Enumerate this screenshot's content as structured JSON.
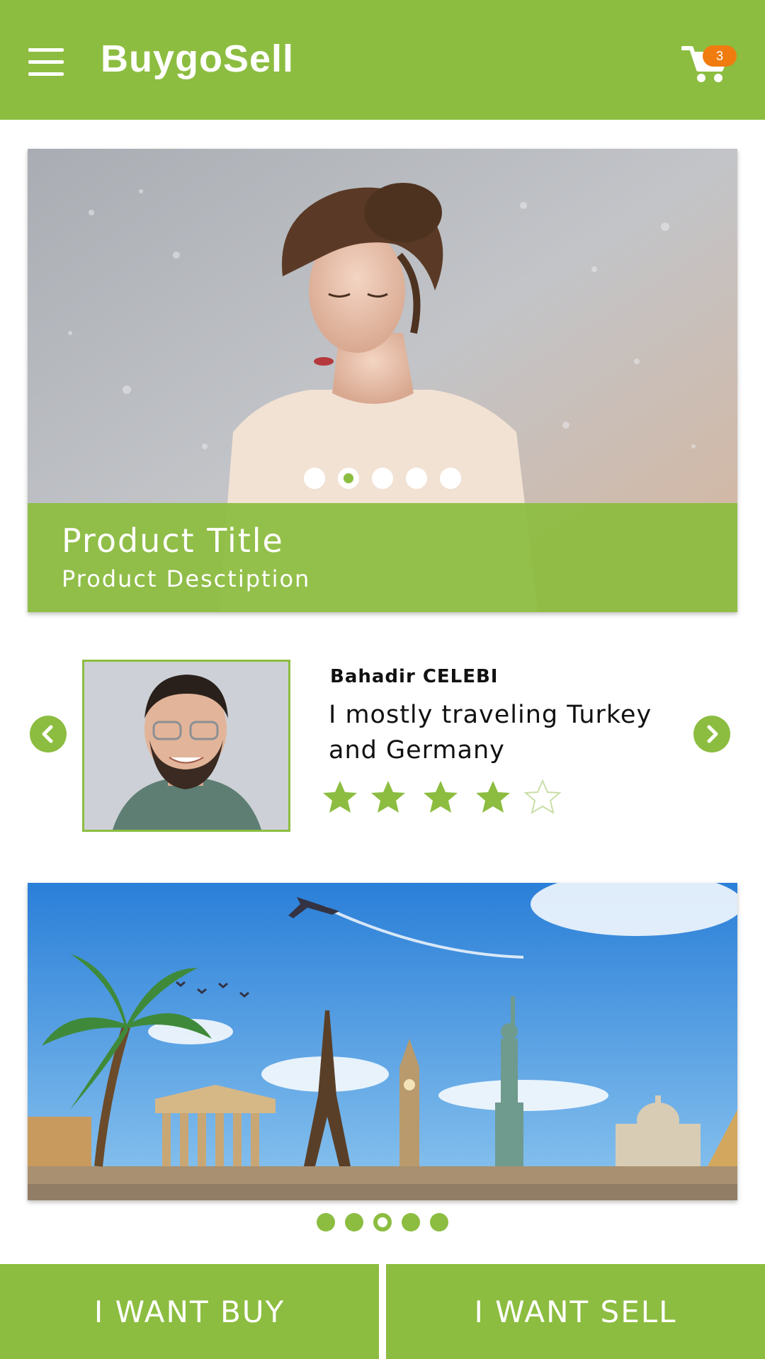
{
  "header": {
    "title": "BuygoSell",
    "cart_count": "3",
    "menu_icon": "hamburger-menu-icon",
    "cart_icon": "shopping-cart-icon"
  },
  "hero": {
    "title": "Product Title",
    "description": "Product Desctiption",
    "slide_count": 5,
    "active_slide": 2
  },
  "testimonial": {
    "name": "Bahadir CELEBI",
    "quote": "I mostly traveling Turkey and Germany",
    "rating": 4,
    "rating_max": 5
  },
  "banner": {
    "slide_count": 5,
    "active_slide": 3
  },
  "actions": {
    "buy_label": "I WANT BUY",
    "sell_label": "I WANT SELL"
  },
  "colors": {
    "accent": "#8cbd40",
    "badge": "#f07c10"
  }
}
